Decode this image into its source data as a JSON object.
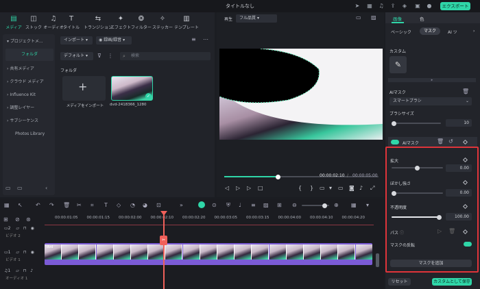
{
  "app": {
    "title": "タイトルなし",
    "export_label": "エクスポート"
  },
  "media_tabs": [
    {
      "label": "メディア",
      "icon": "media-icon"
    },
    {
      "label": "ストック",
      "icon": "stock-icon"
    },
    {
      "label": "オーディオ",
      "icon": "music-icon"
    },
    {
      "label": "タイトル",
      "icon": "text-icon"
    },
    {
      "label": "トランジション",
      "icon": "transition-icon"
    },
    {
      "label": "エフェクト",
      "icon": "effect-icon"
    },
    {
      "label": "フィルター",
      "icon": "filter-icon"
    },
    {
      "label": "ステッカー",
      "icon": "sticker-icon"
    },
    {
      "label": "テンプレート",
      "icon": "template-icon"
    }
  ],
  "sidebar": {
    "items": [
      {
        "label": "プロジェクトメ..."
      },
      {
        "label": "フォルダ"
      },
      {
        "label": "共有メディア"
      },
      {
        "label": "クラウド メディア"
      },
      {
        "label": "Influence Kit"
      },
      {
        "label": "調整レイヤー"
      },
      {
        "label": "サブシーケンス"
      },
      {
        "label": "Photos Library"
      }
    ]
  },
  "library": {
    "import_dropdown": "インポート",
    "mode_dropdown": "録画/録音",
    "default_dropdown": "デフォルト",
    "search_placeholder": "検索",
    "folder_label": "フォルダ",
    "import_tile_label": "メディアをインポート",
    "clip_name": "dvd-2418366_1280"
  },
  "preview": {
    "label": "再生",
    "quality": "フル品質",
    "current_time": "00:00:02:10",
    "separator": "/",
    "total_time": "00:00:05:00",
    "progress": 0.35
  },
  "timeline": {
    "ruler_labels": [
      "00:00:01:05",
      "00:00:01:15",
      "00:00:02:00",
      "00:00:02:10",
      "00:00:02:20",
      "00:00:03:05",
      "00:00:03:15",
      "00:00:04:00",
      "00:00:04:10",
      "00:00:04:20"
    ],
    "tracks": [
      {
        "num": "2",
        "name": "ビデオ 2"
      },
      {
        "num": "1",
        "name": "ビデオ 1"
      },
      {
        "num": "1",
        "name": "オーディオ 1"
      }
    ],
    "clip_label": "dvd"
  },
  "right_panel": {
    "tabs": [
      {
        "label": "画像"
      },
      {
        "label": "色"
      }
    ],
    "subtabs": [
      {
        "label": "ベーシック"
      },
      {
        "label": "マスク"
      },
      {
        "label": "AI ツ"
      }
    ],
    "custom_label": "カスタム",
    "ai_mask_label": "AIマスク",
    "smart_brush": "スマートブラシ",
    "brush_size_label": "ブラシサイズ",
    "brush_size_value": "10",
    "ai_mask_row_label": "AIマスク",
    "expand_label": "拡大",
    "expand_value": "0.00",
    "blur_label": "ぼかし強さ",
    "blur_value": "0.00",
    "opacity_label": "不透明度",
    "opacity_value": "100.00",
    "path_label": "パス",
    "invert_label": "マスクの反転",
    "add_mask_label": "マスクを追加",
    "reset_label": "リセット",
    "save_custom_label": "カスタムとして保存"
  },
  "colors": {
    "accent": "#2fd6a8",
    "highlight_box": "#e0343a",
    "clip_purple": "#7b5bd6",
    "playhead": "#f0605a"
  }
}
